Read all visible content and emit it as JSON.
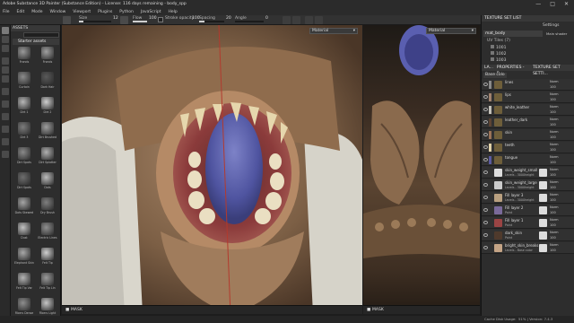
{
  "window": {
    "title": "Adobe Substance 3D Painter (Substance Edition) - License: 116 days remaining - body_spp",
    "controls": [
      "—",
      "□",
      "✕"
    ]
  },
  "menu": [
    "File",
    "Edit",
    "Mode",
    "Window",
    "Viewport",
    "Plugins",
    "Python",
    "JavaScript",
    "Help"
  ],
  "toolbar": {
    "size_label": "Size",
    "size_value": "12",
    "size_fraction": 0.15,
    "flow_label": "Flow",
    "flow_value": "100",
    "flow_fraction": 1.0,
    "stroke_opacity_label": "Stroke opacity",
    "stroke_opacity_value": "100",
    "spacing_label": "Spacing",
    "spacing_value": "20",
    "spacing_fraction": 0.2,
    "angle_label": "Angle",
    "angle_value": "0",
    "settings_label": "Settings",
    "main_shader_label": "Main shader"
  },
  "assets": {
    "header": "ASSETS",
    "source": "Starter assets",
    "items": [
      {
        "label": "Fronds",
        "color": "#9a9a9a"
      },
      {
        "label": "Fronds",
        "color": "#a0a0a0"
      },
      {
        "label": "Curtain",
        "color": "#8c8c8c"
      },
      {
        "label": "Dark Hair",
        "color": "#5a5a5a"
      },
      {
        "label": "Dirt 1",
        "color": "#b7b7b7"
      },
      {
        "label": "Dirt 2",
        "color": "#cfcfcf"
      },
      {
        "label": "Dirt 3",
        "color": "#7d7d7d"
      },
      {
        "label": "Dirt Brushed",
        "color": "#9e9e9e"
      },
      {
        "label": "Dirt Spots",
        "color": "#8a8a8a"
      },
      {
        "label": "Dirt Splatter",
        "color": "#b0b0b0"
      },
      {
        "label": "Dirt Spots",
        "color": "#6e6e6e"
      },
      {
        "label": "Dots",
        "color": "#bcbcbc"
      },
      {
        "label": "Dots Skewed",
        "color": "#a5a5a5"
      },
      {
        "label": "Dry Brush",
        "color": "#7f7f7f"
      },
      {
        "label": "Dust",
        "color": "#c2c2c2"
      },
      {
        "label": "Electric Lines",
        "color": "#8f8f8f"
      },
      {
        "label": "Elephant Skin",
        "color": "#a8a8a8"
      },
      {
        "label": "Felt Tip",
        "color": "#d0d0d0"
      },
      {
        "label": "Felt Tip Var",
        "color": "#b5b5b5"
      },
      {
        "label": "Felt Tip Lin",
        "color": "#9b9b9b"
      },
      {
        "label": "Fibers Dense",
        "color": "#8e8e8e"
      },
      {
        "label": "Fibers Light",
        "color": "#c6c6c6"
      }
    ]
  },
  "viewport3d": {
    "mode": "Material",
    "footer_label": "MASK"
  },
  "viewport2d": {
    "mode": "Material",
    "footer_label": "MASK"
  },
  "texture_set_list": {
    "header": "TEXTURE SET LIST",
    "settings": "Settings",
    "shader": "Main shader",
    "material": "mat_body",
    "uv_tiles_label": "UV Tiles (7)",
    "tiles": [
      "1001",
      "1002",
      "1003"
    ]
  },
  "properties": {
    "tabs": [
      "LA...",
      "PROPERTIES - P...",
      "TEXTURE SET SETTI..."
    ],
    "base_color": "Base colo",
    "layers": [
      {
        "name": "lines",
        "sub": "",
        "blend": "Norm",
        "opacity": "100",
        "color": "#8a8a8a",
        "folder": true
      },
      {
        "name": "lips",
        "sub": "",
        "blend": "Norm",
        "opacity": "100",
        "color": "#a0826e",
        "folder": true
      },
      {
        "name": "white_leather",
        "sub": "",
        "blend": "Norm",
        "opacity": "100",
        "color": "#c2c0b8",
        "folder": true
      },
      {
        "name": "leather_dark",
        "sub": "",
        "blend": "Norm",
        "opacity": "100",
        "color": "#5c4434",
        "folder": true
      },
      {
        "name": "skin",
        "sub": "",
        "blend": "Norm",
        "opacity": "100",
        "color": "#9a7358",
        "folder": true
      },
      {
        "name": "teeth",
        "sub": "",
        "blend": "Norm",
        "opacity": "100",
        "color": "#e0d1a8",
        "folder": true
      },
      {
        "name": "tongue",
        "sub": "",
        "blend": "Norm",
        "opacity": "100",
        "color": "#5a5a9e",
        "folder": true
      },
      {
        "name": "skin_weight_small",
        "sub": "Levels - 3000height",
        "blend": "Norm",
        "opacity": "100",
        "color": "#dddddd",
        "folder": false
      },
      {
        "name": "skin_weight_large",
        "sub": "Levels - 3000height",
        "blend": "Norm",
        "opacity": "100",
        "color": "#cccccc",
        "folder": false
      },
      {
        "name": "Fill layer 3",
        "sub": "Levels - 3000height",
        "blend": "Norm",
        "opacity": "100",
        "color": "#b9a080",
        "folder": false
      },
      {
        "name": "Fill layer 2",
        "sub": "Paint",
        "blend": "Norm",
        "opacity": "100",
        "color": "#7a6a9a",
        "folder": false
      },
      {
        "name": "Fill layer 1",
        "sub": "Paint",
        "blend": "Norm",
        "opacity": "100",
        "color": "#9a4444",
        "folder": false
      },
      {
        "name": "dark_skin",
        "sub": "Paint",
        "blend": "Norm",
        "opacity": "100",
        "color": "#4f3a2c",
        "folder": false
      },
      {
        "name": "bright_skin_breaks",
        "sub": "Levels - Base color",
        "blend": "Norm",
        "opacity": "100",
        "color": "#c4a486",
        "folder": false
      }
    ]
  },
  "status": {
    "cache": "Cache Disk Usage:",
    "cache_value": "51% | Version: 7.4.3"
  }
}
